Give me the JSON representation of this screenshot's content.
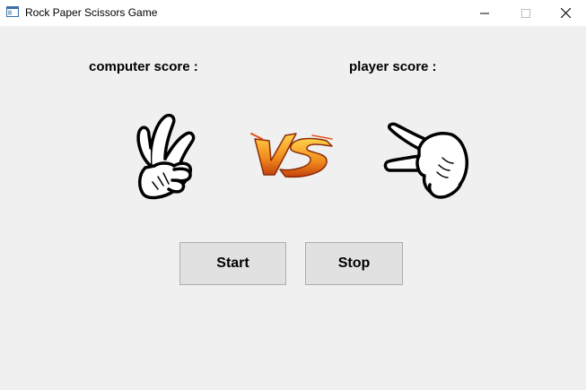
{
  "window": {
    "title": "Rock Paper Scissors Game",
    "controls": {
      "minimize": "minimize-icon",
      "maximize": "maximize-icon",
      "close": "close-icon"
    }
  },
  "scores": {
    "computer_label": "computer score :",
    "player_label": "player score :"
  },
  "icons": {
    "computer_hand": "scissors-hand-icon",
    "versus": "vs-icon",
    "player_hand": "scissors-hand-icon"
  },
  "buttons": {
    "start_label": "Start",
    "stop_label": "Stop"
  },
  "colors": {
    "background": "#f0f0f0",
    "button_face": "#e1e1e1",
    "button_border": "#adadad",
    "vs_fire": "#f08a1c"
  }
}
